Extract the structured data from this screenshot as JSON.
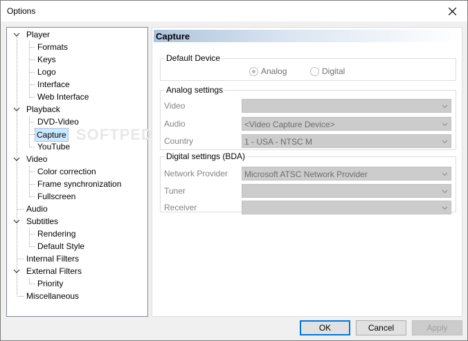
{
  "window": {
    "title": "Options"
  },
  "tree": {
    "player": "Player",
    "formats": "Formats",
    "keys": "Keys",
    "logo": "Logo",
    "interface": "Interface",
    "web_interface": "Web Interface",
    "playback": "Playback",
    "dvd_video": "DVD-Video",
    "capture": "Capture",
    "youtube": "YouTube",
    "video": "Video",
    "color_correction": "Color correction",
    "frame_sync": "Frame synchronization",
    "fullscreen": "Fullscreen",
    "audio": "Audio",
    "subtitles": "Subtitles",
    "rendering": "Rendering",
    "default_style": "Default Style",
    "internal_filters": "Internal Filters",
    "external_filters": "External Filters",
    "priority": "Priority",
    "miscellaneous": "Miscellaneous"
  },
  "panel": {
    "header": "Capture",
    "default_device": {
      "label": "Default Device",
      "analog": "Analog",
      "digital": "Digital",
      "selected": "Analog"
    },
    "analog": {
      "label": "Analog settings",
      "video_label": "Video",
      "video_value": "",
      "audio_label": "Audio",
      "audio_value": "<Video Capture Device>",
      "country_label": "Country",
      "country_value": "1 - USA - NTSC M"
    },
    "digital": {
      "label": "Digital settings (BDA)",
      "network_label": "Network Provider",
      "network_value": "Microsoft ATSC Network Provider",
      "tuner_label": "Tuner",
      "tuner_value": "",
      "receiver_label": "Receiver",
      "receiver_value": ""
    }
  },
  "buttons": {
    "ok": "OK",
    "cancel": "Cancel",
    "apply": "Apply"
  },
  "watermark": "SOFTPEDIA",
  "colors": {
    "selection": "#cce8ff",
    "ok_border": "#0078d7"
  }
}
